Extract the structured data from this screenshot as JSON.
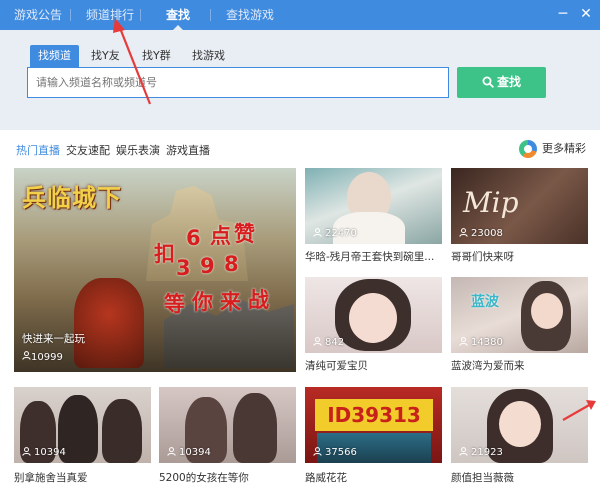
{
  "nav": {
    "items": [
      "游戏公告",
      "频道排行",
      "查找",
      "查找游戏"
    ],
    "active_index": 2,
    "minimize_glyph": "─",
    "close_glyph": "✕"
  },
  "search": {
    "tabs": [
      "找频道",
      "找Y友",
      "找Y群",
      "找游戏"
    ],
    "active_tab": 0,
    "placeholder": "请输入频道名称或频道号",
    "button_label": "查找",
    "button_icon": "search-icon"
  },
  "categories": {
    "items": [
      "热门直播",
      "交友速配",
      "娱乐表演",
      "游戏直播"
    ],
    "active_index": 0,
    "more_label": "更多精彩"
  },
  "featured": {
    "banner_title": "兵临城下",
    "overlay_chars": [
      "扣",
      "6",
      "点",
      "赞",
      "3",
      "9",
      "8",
      "等",
      "你",
      "来",
      "战"
    ],
    "title": "快进来一起玩",
    "viewers": "10999"
  },
  "channels": [
    {
      "title": "华晗-残月帝王套快到碗里...",
      "viewers": "22470",
      "badge": ""
    },
    {
      "title": "哥哥们快来呀",
      "viewers": "23008",
      "badge": "Mip"
    },
    {
      "title": "清纯可爱宝贝",
      "viewers": "842",
      "badge": ""
    },
    {
      "title": "蓝波湾为爱而来",
      "viewers": "14380",
      "badge": "蓝波"
    },
    {
      "title": "别拿施舍当真爱",
      "viewers": "10394",
      "badge": ""
    },
    {
      "title": "5200的女孩在等你",
      "viewers": "10394",
      "badge": ""
    },
    {
      "title": "路威花花",
      "viewers": "37566",
      "badge": "ID39313"
    },
    {
      "title": "颜值担当薇薇",
      "viewers": "21923",
      "badge": ""
    }
  ],
  "colors": {
    "accent": "#3f8be0",
    "search_button": "#3dc288",
    "annotation_arrow": "#e63b3b"
  }
}
